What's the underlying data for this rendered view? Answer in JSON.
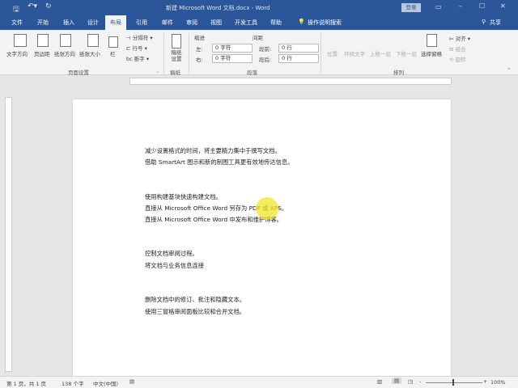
{
  "title": "新建 Microsoft Word 文档.docx - Word",
  "login": "登录",
  "tabs": [
    "文件",
    "开始",
    "插入",
    "设计",
    "布局",
    "引用",
    "邮件",
    "审阅",
    "视图",
    "开发工具",
    "帮助"
  ],
  "active_tab": "布局",
  "tell_me": "操作说明搜索",
  "share": "共享",
  "ribbon": {
    "page_setup": {
      "label": "页面设置",
      "buttons": [
        "文字方向",
        "页边距",
        "纸张方向",
        "纸张大小",
        "栏"
      ],
      "small": [
        "分隔符",
        "行号",
        "断字"
      ]
    },
    "draft": {
      "label": "稿纸",
      "button": "稿纸设置"
    },
    "paragraph": {
      "label": "段落",
      "indent": "缩进",
      "spacing": "间距",
      "left_label": "左:",
      "right_label": "右:",
      "before_label": "段前:",
      "after_label": "段后:",
      "left": "0 字符",
      "right": "0 字符",
      "before": "0 行",
      "after": "0 行"
    },
    "arrange": {
      "label": "排列",
      "buttons": [
        "位置",
        "环绕文字",
        "上移一层",
        "下移一层",
        "选择窗格"
      ],
      "small": [
        "对齐",
        "组合",
        "旋转"
      ]
    }
  },
  "document": {
    "lines": [
      "减少设置格式的时间，将主要精力集中于撰写文档。",
      "借助 SmartArt 图示和新的制图工具更有效地传达信息。",
      "使用构建基块快速构建文档。",
      "直接从 Microsoft Office Word 另存为 PDF 或 XPS。",
      "直接从 Microsoft Office Word 中发布和维护博客。",
      "控制文档审阅过程。",
      "将文档与业务信息连接",
      "删除文档中的修订、批注和隐藏文本。",
      "使用三窗格审阅面板比较和合并文档。"
    ]
  },
  "status": {
    "page": "第 1 页，共 1 页",
    "words": "138 个字",
    "lang": "中文(中国)",
    "zoom": "100%"
  },
  "zoom_percent": 100
}
